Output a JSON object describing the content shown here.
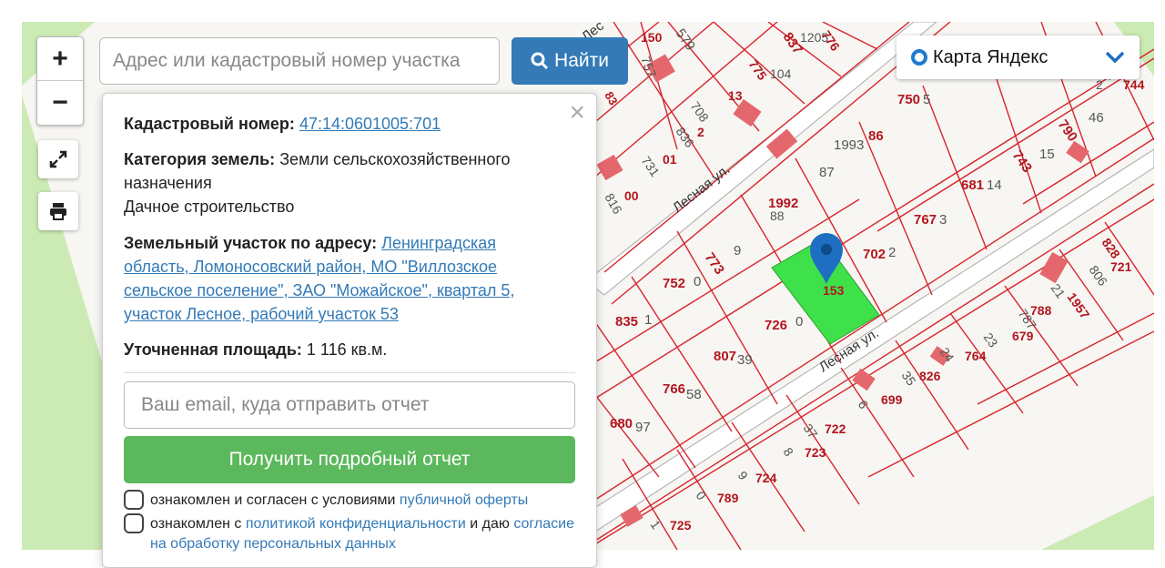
{
  "search": {
    "placeholder": "Адрес или кадастровый номер участка",
    "button_label": "Найти"
  },
  "zoom": {
    "in_label": "+",
    "out_label": "−"
  },
  "layer": {
    "label": "Карта Яндекс"
  },
  "popup": {
    "cadastral_label": "Кадастровый номер:",
    "cadastral_number": "47:14:0601005:701",
    "category_label": "Категория земель:",
    "category_value": "Земли сельскохозяйственного назначения",
    "use_value": "Дачное строительство",
    "address_label": "Земельный участок по адресу:",
    "address_value": "Ленинградская область, Ломоносовский район, МО \"Виллозское сельское поселение\", ЗАО \"Можайское\", квартал 5, участок Лесное, рабочий участок 53",
    "area_label": "Уточненная площадь:",
    "area_value": "1 116 кв.м.",
    "email_placeholder": "Ваш email, куда отправить отчет",
    "report_button": "Получить подробный отчет",
    "agree1_text": "ознакомлен и согласен с условиями",
    "agree1_link": "публичной оферты",
    "agree2_text": "ознакомлен с",
    "agree2_link": "политикой конфиденциальности",
    "agree2_text2": "и даю",
    "agree2_link2": "согласие на обработку персональных данных"
  },
  "map": {
    "streets": [
      "Лесная ул.",
      "Лесная ул.",
      "Лес"
    ],
    "parcels": [
      "150",
      "579",
      "837",
      "1205",
      "776",
      "757",
      "775",
      "104",
      "83",
      "708",
      "13",
      "836",
      "2",
      "731",
      "01",
      "816",
      "00",
      "1993",
      "86",
      "87",
      "750",
      "5",
      "790",
      "46",
      "743",
      "15",
      "681",
      "14",
      "767",
      "3",
      "702",
      "2",
      "1992",
      "88",
      "773",
      "9",
      "752",
      "0",
      "726",
      "0",
      "835",
      "1",
      "807",
      "39",
      "766",
      "58",
      "680",
      "97",
      "828",
      "806",
      "721",
      "21",
      "1957",
      "787",
      "788",
      "23",
      "679",
      "24",
      "764",
      "35",
      "826",
      "6",
      "699",
      "37",
      "722",
      "8",
      "723",
      "9",
      "724",
      "0",
      "789",
      "1",
      "725",
      "2",
      "744",
      "7",
      "153",
      "701"
    ],
    "colors": {
      "boundary": "#d9232d",
      "parcel_fill": "#f7f6f2",
      "selected_fill": "#3fe14a",
      "road": "#ffffff",
      "green": "#cbeab4",
      "label": "#b3161f",
      "marker": "#1e6fc2"
    }
  }
}
